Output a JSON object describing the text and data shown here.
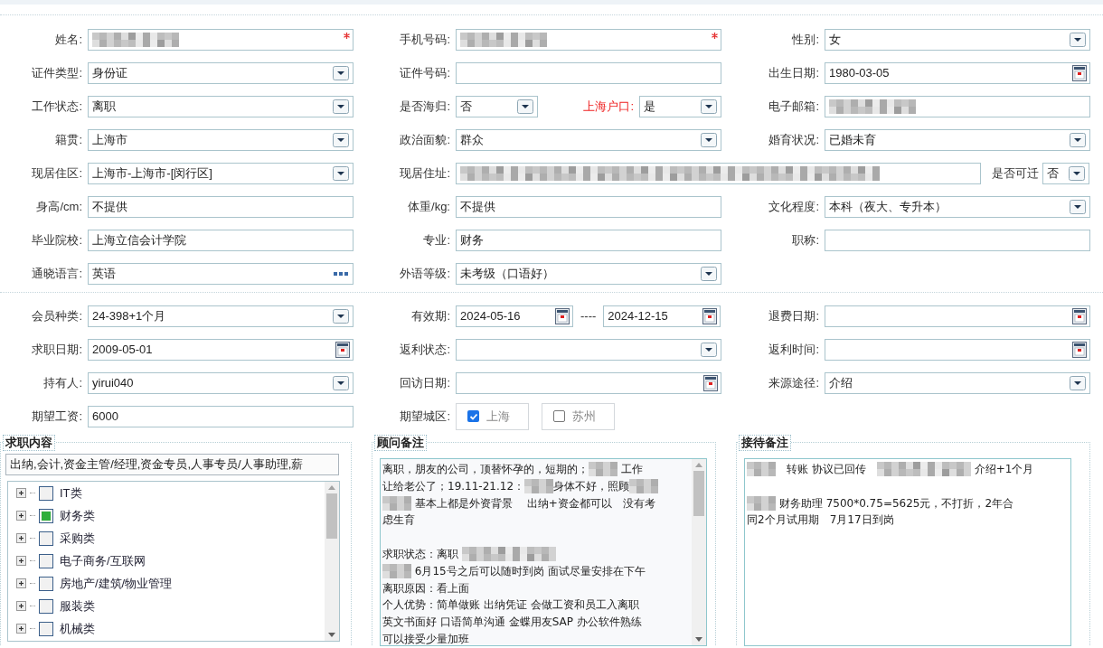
{
  "sections": [
    {
      "rows": [
        {
          "kind": "three",
          "items": [
            {
              "label": "姓名:",
              "emphasized": false,
              "control": {
                "kind": "blurred",
                "required": true
              }
            },
            {
              "label": "手机号码:",
              "emphasized": false,
              "control": {
                "kind": "blurred",
                "required": true
              }
            },
            {
              "label": "性别:",
              "emphasized": false,
              "control": {
                "kind": "select",
                "value": "女",
                "required": false
              }
            }
          ]
        },
        {
          "kind": "three",
          "items": [
            {
              "label": "证件类型:",
              "emphasized": false,
              "control": {
                "kind": "select",
                "value": "身份证",
                "required": false
              }
            },
            {
              "label": "证件号码:",
              "emphasized": false,
              "control": {
                "kind": "text",
                "required": false
              }
            },
            {
              "label": "出生日期:",
              "emphasized": false,
              "control": {
                "kind": "date",
                "value": "1980-03-05",
                "required": false
              }
            }
          ]
        },
        {
          "kind": "three",
          "items": [
            {
              "label": "工作状态:",
              "emphasized": false,
              "control": {
                "kind": "select",
                "value": "离职",
                "required": false
              }
            },
            {
              "label": "是否海归:",
              "emphasized": false,
              "control": {
                "kind": "select",
                "value": "否",
                "required": false
              },
              "extra": {
                "label": "上海户口:",
                "emphasized": true,
                "control": {
                  "kind": "select",
                  "value": "是",
                  "required": false
                }
              }
            },
            {
              "label": "电子邮箱:",
              "emphasized": false,
              "control": {
                "kind": "blurred",
                "required": false
              }
            }
          ]
        },
        {
          "kind": "three",
          "items": [
            {
              "label": "籍贯:",
              "emphasized": false,
              "control": {
                "kind": "select",
                "value": "上海市",
                "required": false
              }
            },
            {
              "label": "政治面貌:",
              "emphasized": false,
              "control": {
                "kind": "select",
                "value": "群众",
                "required": false
              }
            },
            {
              "label": "婚育状况:",
              "emphasized": false,
              "control": {
                "kind": "select",
                "value": "已婚未育",
                "required": false
              }
            }
          ]
        },
        {
          "kind": "address",
          "items": [
            {
              "label": "现居住区:",
              "emphasized": false,
              "control": {
                "kind": "select",
                "value": "上海市-上海市-[闵行区]",
                "required": false
              }
            },
            {
              "label": "现居住址:",
              "emphasized": false,
              "control": {
                "kind": "longblurred",
                "required": false
              },
              "extra": {
                "label": "是否可迁",
                "emphasized": false,
                "control": {
                  "kind": "select",
                  "value": "否",
                  "required": false
                }
              }
            }
          ]
        },
        {
          "kind": "three",
          "items": [
            {
              "label": "身高/cm:",
              "emphasized": false,
              "control": {
                "kind": "text",
                "value": "不提供",
                "required": false
              }
            },
            {
              "label": "体重/kg:",
              "emphasized": false,
              "control": {
                "kind": "text",
                "value": "不提供",
                "required": false
              }
            },
            {
              "label": "文化程度:",
              "emphasized": false,
              "control": {
                "kind": "select",
                "value": "本科（夜大、专升本）",
                "required": false
              }
            }
          ]
        },
        {
          "kind": "three",
          "items": [
            {
              "label": "毕业院校:",
              "emphasized": false,
              "control": {
                "kind": "text",
                "value": "上海立信会计学院",
                "required": false
              }
            },
            {
              "label": "专业:",
              "emphasized": false,
              "control": {
                "kind": "text",
                "value": "财务",
                "required": false
              }
            },
            {
              "label": "职称:",
              "emphasized": false,
              "control": {
                "kind": "text",
                "required": false
              }
            }
          ]
        },
        {
          "kind": "three",
          "items": [
            {
              "label": "通晓语言:",
              "emphasized": false,
              "control": {
                "kind": "lookup",
                "value": "英语",
                "required": false
              }
            },
            {
              "label": "外语等级:",
              "emphasized": false,
              "control": {
                "kind": "select",
                "value": "未考级（口语好）",
                "required": false
              }
            }
          ]
        }
      ]
    },
    {
      "rows": [
        {
          "kind": "three",
          "items": [
            {
              "label": "会员种类:",
              "emphasized": false,
              "control": {
                "kind": "select",
                "value": "24-398+1个月",
                "required": false
              }
            },
            {
              "label": "有效期:",
              "emphasized": false,
              "control": {
                "kind": "daterange",
                "from": "2024-05-16",
                "separator": "----",
                "to": "2024-12-15",
                "required": false
              }
            },
            {
              "label": "退费日期:",
              "emphasized": false,
              "control": {
                "kind": "date",
                "required": false
              }
            }
          ]
        },
        {
          "kind": "three",
          "items": [
            {
              "label": "求职日期:",
              "emphasized": false,
              "control": {
                "kind": "date",
                "value": "2009-05-01",
                "required": false
              }
            },
            {
              "label": "返利状态:",
              "emphasized": false,
              "control": {
                "kind": "select",
                "required": false
              }
            },
            {
              "label": "返利时间:",
              "emphasized": false,
              "control": {
                "kind": "date",
                "required": false
              }
            }
          ]
        },
        {
          "kind": "three",
          "items": [
            {
              "label": "持有人:",
              "emphasized": false,
              "control": {
                "kind": "select",
                "value": "yirui040",
                "required": false
              }
            },
            {
              "label": "回访日期:",
              "emphasized": false,
              "control": {
                "kind": "date",
                "required": false
              }
            },
            {
              "label": "来源途径:",
              "emphasized": false,
              "control": {
                "kind": "select",
                "value": "介绍",
                "required": false
              }
            }
          ]
        },
        {
          "kind": "three",
          "items": [
            {
              "label": "期望工资:",
              "emphasized": false,
              "control": {
                "kind": "text",
                "value": "6000",
                "required": false
              }
            },
            {
              "label": "期望城区:",
              "emphasized": false,
              "control": {
                "kind": "checkboxes",
                "required": false,
                "options": [
                  {
                    "label": "上海",
                    "checked": true
                  },
                  {
                    "label": "苏州",
                    "checked": false
                  }
                ]
              }
            }
          ]
        }
      ]
    }
  ],
  "job_content": {
    "title": "求职内容",
    "value": "出纳,会计,资金主管/经理,资金专员,人事专员/人事助理,薪",
    "tree": [
      {
        "label": "IT类",
        "checked": false,
        "expanded": false
      },
      {
        "label": "财务类",
        "checked": true,
        "expanded": false
      },
      {
        "label": "采购类",
        "checked": false,
        "expanded": false
      },
      {
        "label": "电子商务/互联网",
        "checked": false,
        "expanded": false
      },
      {
        "label": "房地产/建筑/物业管理",
        "checked": false,
        "expanded": false
      },
      {
        "label": "服装类",
        "checked": false,
        "expanded": false
      },
      {
        "label": "机械类",
        "checked": false,
        "expanded": false
      }
    ]
  },
  "notes": [
    {
      "title": "顾问备注",
      "scrollbar": true,
      "paragraphs": [
        [
          [
            {
              "kind": "text",
              "text": "离职，朋友的公司，顶替怀孕的，短期的；"
            },
            {
              "kind": "blur"
            },
            {
              "kind": "text",
              "text": " 工作"
            }
          ],
          [
            {
              "kind": "text",
              "text": "让给老公了；19.11-21.12："
            },
            {
              "kind": "blur"
            },
            {
              "kind": "text",
              "text": "身体不好，照顾"
            },
            {
              "kind": "blur"
            }
          ],
          [
            {
              "kind": "blur"
            },
            {
              "kind": "text",
              "text": " 基本上都是外资背景　 出纳+资金都可以　没有考"
            }
          ],
          [
            {
              "kind": "text",
              "text": "虑生育"
            }
          ]
        ],
        [
          [
            {
              "kind": "text",
              "text": "求职状态：离职 "
            },
            {
              "kind": "longblur"
            }
          ],
          [
            {
              "kind": "blur"
            },
            {
              "kind": "text",
              "text": " 6月15号之后可以随时到岗 面试尽量安排在下午"
            }
          ],
          [
            {
              "kind": "text",
              "text": "离职原因：看上面"
            }
          ],
          [
            {
              "kind": "text",
              "text": "个人优势：简单做账 出纳凭证 会做工资和员工入离职"
            }
          ],
          [
            {
              "kind": "text",
              "text": "英文书面好 口语简单沟通 金蝶用友SAP 办公软件熟练"
            }
          ],
          [
            {
              "kind": "text",
              "text": "可以接受少量加班"
            }
          ]
        ]
      ]
    },
    {
      "title": "接待备注",
      "scrollbar": false,
      "paragraphs": [
        [
          [
            {
              "kind": "blur"
            },
            {
              "kind": "text",
              "text": "　转账 协议已回传　"
            },
            {
              "kind": "longblur"
            },
            {
              "kind": "text",
              "text": " 介绍+1个月"
            }
          ]
        ],
        [
          [
            {
              "kind": "blur"
            },
            {
              "kind": "text",
              "text": " 财务助理 7500*0.75=5625元，不打折，2年合"
            }
          ],
          [
            {
              "kind": "text",
              "text": "同2个月试用期　7月17日到岗"
            }
          ]
        ]
      ]
    }
  ]
}
